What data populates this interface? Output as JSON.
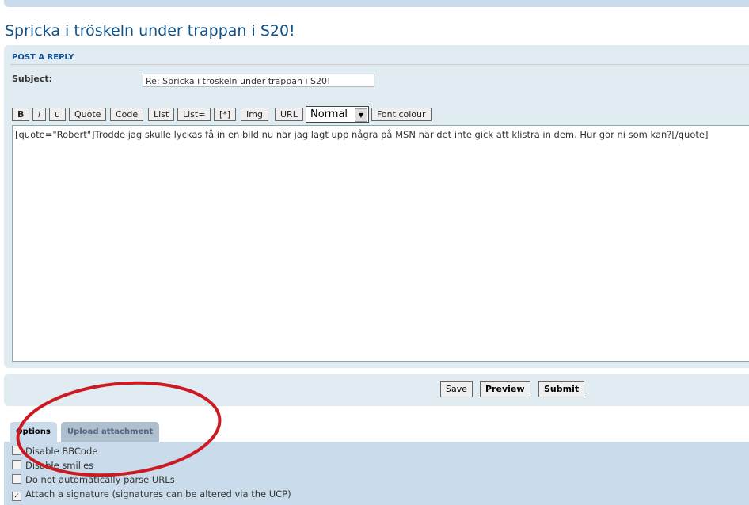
{
  "topic_title": "Spricka i tröskeln under trappan i S20!",
  "post_reply": {
    "heading": "POST A REPLY",
    "subject_label": "Subject:",
    "subject_value": "Re: Spricka i tröskeln under trappan i S20!"
  },
  "toolbar": {
    "buttons": [
      "B",
      "i",
      "u",
      "Quote",
      "Code",
      "List",
      "List=",
      "[*]",
      "Img",
      "URL"
    ],
    "font_size": "Normal",
    "font_colour": "Font colour"
  },
  "message": "[quote=\"Robert\"]Trodde jag skulle lyckas få in en bild nu när jag lagt upp några på MSN när det inte gick att klistra in dem. Hur gör ni som kan?[/quote]",
  "actions": {
    "save": "Save",
    "preview": "Preview",
    "submit": "Submit"
  },
  "tabs": [
    {
      "label": "Options",
      "active": true
    },
    {
      "label": "Upload attachment",
      "active": false
    }
  ],
  "options": [
    {
      "label": "Disable BBCode",
      "checked": false
    },
    {
      "label": "Disable smilies",
      "checked": false
    },
    {
      "label": "Do not automatically parse URLs",
      "checked": false
    },
    {
      "label": "Attach a signature (signatures can be altered via the UCP)",
      "checked": true
    }
  ],
  "annotation_color": "#cc1a22"
}
